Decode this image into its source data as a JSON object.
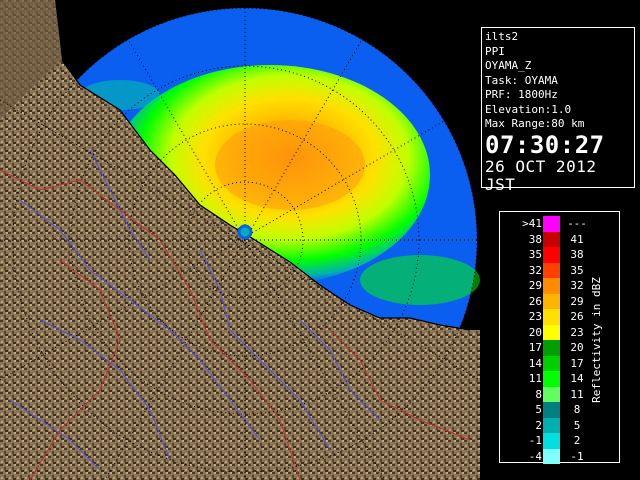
{
  "info": {
    "lines": [
      "ilts2",
      "PPI",
      "OYAMA_Z",
      "Task: OYAMA",
      "PRF: 1800Hz",
      "Elevation:1.0",
      "Max Range:80 km"
    ],
    "time": "07:30:27",
    "date": "26 OCT 2012 JST"
  },
  "legend": {
    "title": "Reflectivity in dBZ",
    "rows": [
      {
        "lo": ">41",
        "hi": "---",
        "color": "#ff00ff"
      },
      {
        "lo": "38",
        "hi": "41",
        "color": "#c80000"
      },
      {
        "lo": "35",
        "hi": "38",
        "color": "#ff0000"
      },
      {
        "lo": "32",
        "hi": "35",
        "color": "#ff4000"
      },
      {
        "lo": "29",
        "hi": "32",
        "color": "#ff8c00"
      },
      {
        "lo": "26",
        "hi": "29",
        "color": "#ffb400"
      },
      {
        "lo": "23",
        "hi": "26",
        "color": "#ffe000"
      },
      {
        "lo": "20",
        "hi": "23",
        "color": "#ffff00"
      },
      {
        "lo": "17",
        "hi": "20",
        "color": "#00a000"
      },
      {
        "lo": "14",
        "hi": "17",
        "color": "#00d000"
      },
      {
        "lo": "11",
        "hi": "14",
        "color": "#00ff00"
      },
      {
        "lo": "8",
        "hi": "11",
        "color": "#60ff60"
      },
      {
        "lo": "5",
        "hi": "8",
        "color": "#008080"
      },
      {
        "lo": "2",
        "hi": "5",
        "color": "#00b0b0"
      },
      {
        "lo": "-1",
        "hi": "2",
        "color": "#00e0e0"
      },
      {
        "lo": "-4",
        "hi": "-1",
        "color": "#80ffff"
      }
    ]
  },
  "colors": {
    "echo_blue": "#0a5ff0",
    "land": "#8a7556",
    "land_dark": "#4a3a26",
    "river": "#5050e0",
    "border": "#c03030"
  }
}
